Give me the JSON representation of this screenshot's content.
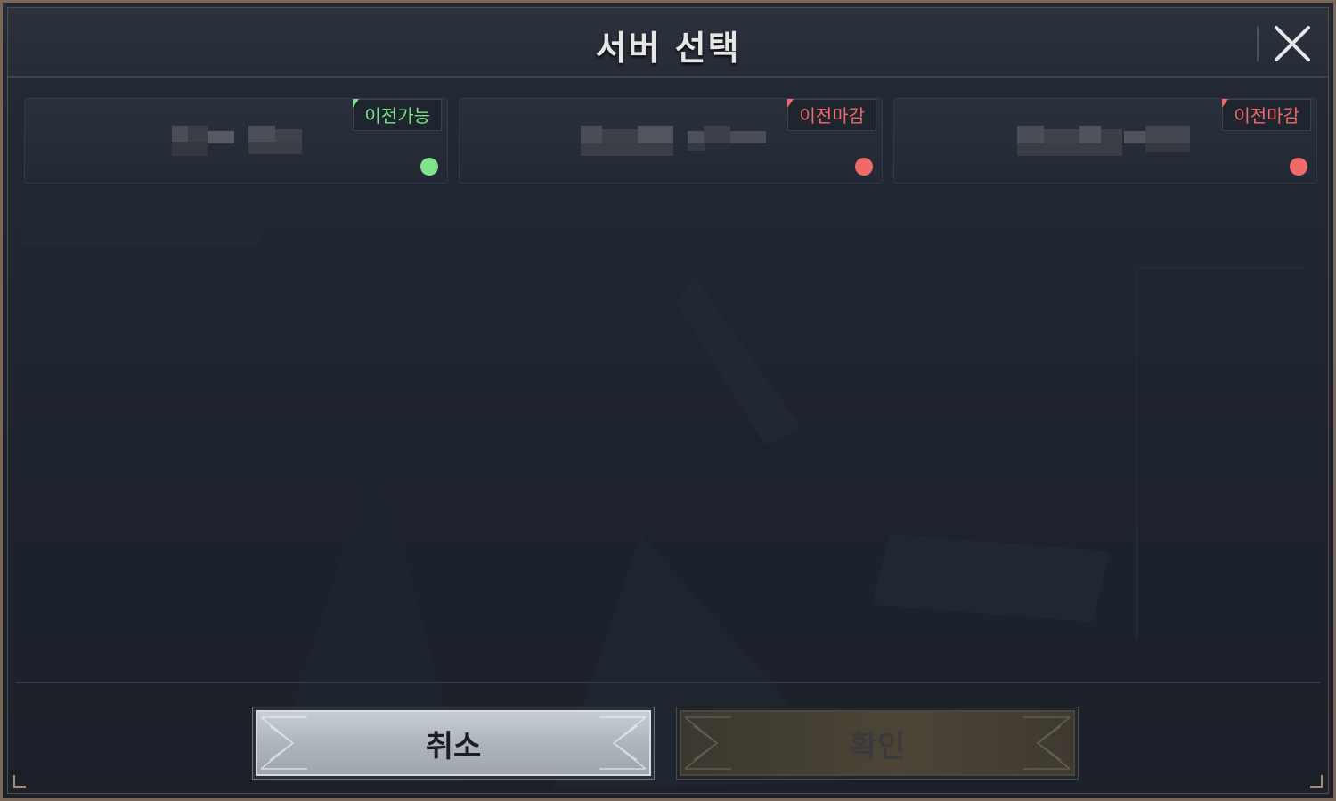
{
  "header": {
    "title": "서버 선택",
    "close_icon": "close-icon"
  },
  "servers": [
    {
      "status": "이전가능",
      "status_type": "ok",
      "dot_color": "#7ee38a"
    },
    {
      "status": "이전마감",
      "status_type": "closed",
      "dot_color": "#f06a6a"
    },
    {
      "status": "이전마감",
      "status_type": "closed",
      "dot_color": "#f06a6a"
    }
  ],
  "buttons": {
    "cancel": "취소",
    "confirm": "확인"
  }
}
